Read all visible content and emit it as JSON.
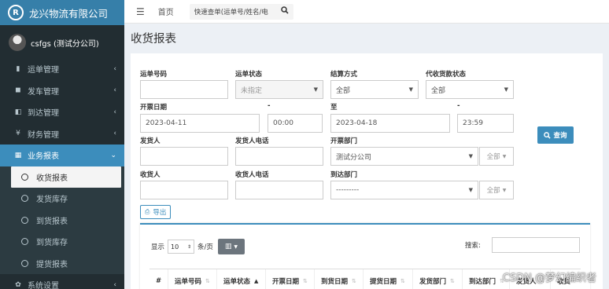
{
  "app": {
    "title": "龙兴物流有限公司",
    "logo_char": "R"
  },
  "user": {
    "name": "csfgs (测试分公司)"
  },
  "sidebar": {
    "items": [
      {
        "label": "运单管理",
        "icon": "clipboard-icon",
        "glyph": "▮"
      },
      {
        "label": "发车管理",
        "icon": "truck-icon",
        "glyph": "◼"
      },
      {
        "label": "到达管理",
        "icon": "truck-arrive-icon",
        "glyph": "◧"
      },
      {
        "label": "财务管理",
        "icon": "yen-icon",
        "glyph": "¥"
      },
      {
        "label": "业务报表",
        "icon": "table-icon",
        "glyph": "▦"
      }
    ],
    "subitems": [
      "收货报表",
      "发货库存",
      "到货报表",
      "到货库存",
      "提货报表"
    ],
    "settings": {
      "label": "系统设置",
      "glyph": "✿"
    }
  },
  "topbar": {
    "home": "首页",
    "quick_search_placeholder": "快速查单(运单号/姓名/电"
  },
  "page": {
    "title": "收货报表"
  },
  "form": {
    "waybill_no": {
      "label": "运单号码",
      "value": ""
    },
    "waybill_status": {
      "label": "运单状态",
      "value": "未指定"
    },
    "settle_method": {
      "label": "结算方式",
      "value": "全部"
    },
    "cod_status": {
      "label": "代收货款状态",
      "value": "全部"
    },
    "invoice_date": {
      "label": "开票日期",
      "value": "2023-04-11"
    },
    "dash": "-",
    "time_from": {
      "value": "00:00"
    },
    "to": {
      "label": "至",
      "value": "2023-04-18"
    },
    "time_to": {
      "value": "23:59"
    },
    "shipper": {
      "label": "发货人",
      "value": ""
    },
    "shipper_phone": {
      "label": "发货人电话",
      "value": ""
    },
    "invoice_dept": {
      "label": "开票部门",
      "value": "测试分公司",
      "scope": "全部"
    },
    "consignee": {
      "label": "收货人",
      "value": ""
    },
    "consignee_phone": {
      "label": "收货人电话",
      "value": ""
    },
    "arrival_dept": {
      "label": "到达部门",
      "value": "---------",
      "scope": "全部"
    },
    "query_btn": "查询",
    "export_btn": "导出"
  },
  "table": {
    "show_label": "显示",
    "page_size": "10",
    "per_page": "条/页",
    "search_label": "搜索:",
    "columns": [
      "#",
      "运单号码",
      "运单状态",
      "开票日期",
      "到货日期",
      "提货日期",
      "发货部门",
      "到达部门",
      "发货人",
      "收货"
    ]
  },
  "watermark": "CSDN @梦幻编织者"
}
